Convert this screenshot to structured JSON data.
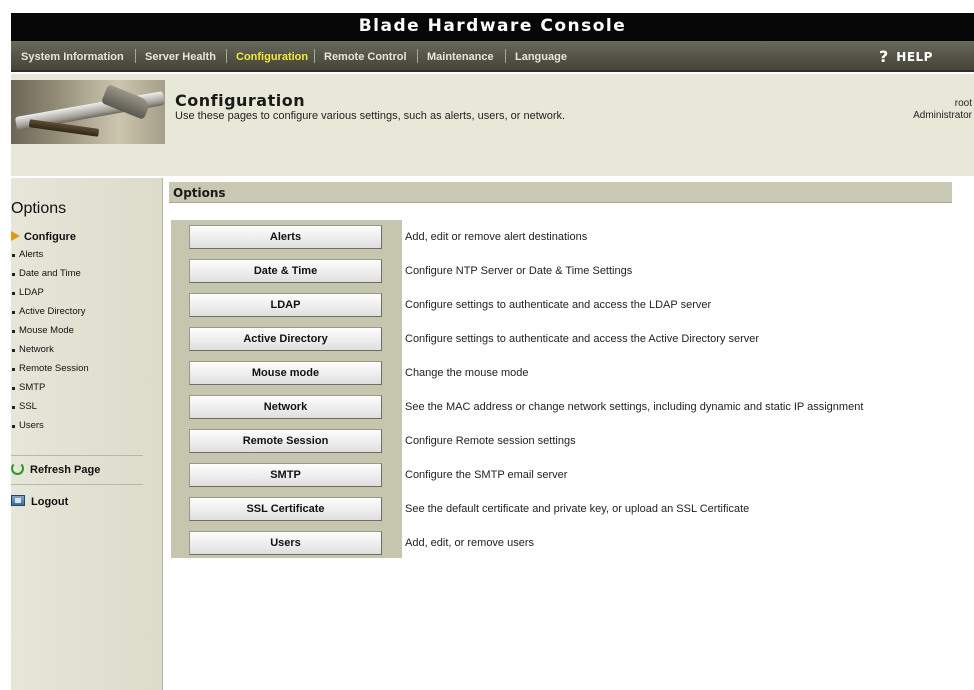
{
  "window": {
    "title": "Blade Hardware Console"
  },
  "nav": {
    "items": [
      {
        "label": "System Information",
        "active": false
      },
      {
        "label": "Server Health",
        "active": false
      },
      {
        "label": "Configuration",
        "active": true
      },
      {
        "label": "Remote Control",
        "active": false
      },
      {
        "label": "Maintenance",
        "active": false
      },
      {
        "label": "Language",
        "active": false
      }
    ],
    "help": {
      "icon": "question-icon",
      "glyph": "?",
      "label": "HELP"
    }
  },
  "banner": {
    "logo_icon": "hammer-tools-logo",
    "title": "Configuration",
    "description": "Use these pages to configure various settings, such as alerts, users, or network.",
    "user": "root",
    "role": "Administrator"
  },
  "sidebar": {
    "title": "Options",
    "group": {
      "label": "Configure",
      "icon": "triangle-right-icon"
    },
    "items": [
      "Alerts",
      "Date and Time",
      "LDAP",
      "Active Directory",
      "Mouse Mode",
      "Network",
      "Remote Session",
      "SMTP",
      "SSL",
      "Users"
    ],
    "actions": [
      {
        "label": "Refresh Page",
        "icon": "refresh-icon"
      },
      {
        "label": "Logout",
        "icon": "logout-icon"
      }
    ]
  },
  "content": {
    "header": "Options",
    "options": [
      {
        "button": "Alerts",
        "description": "Add, edit or remove alert destinations"
      },
      {
        "button": "Date & Time",
        "description": "Configure NTP Server or Date & Time Settings"
      },
      {
        "button": "LDAP",
        "description": "Configure settings to authenticate and access the LDAP server"
      },
      {
        "button": "Active Directory",
        "description": "Configure settings to authenticate and access the Active Directory server"
      },
      {
        "button": "Mouse mode",
        "description": "Change the mouse mode"
      },
      {
        "button": "Network",
        "description": "See the MAC address or change network settings, including dynamic and static IP assignment"
      },
      {
        "button": "Remote Session",
        "description": "Configure Remote session settings"
      },
      {
        "button": "SMTP",
        "description": "Configure the SMTP email server"
      },
      {
        "button": "SSL Certificate",
        "description": "See the default certificate and private key, or upload an SSL Certificate"
      },
      {
        "button": "Users",
        "description": "Add, edit, or remove users"
      }
    ]
  },
  "colors": {
    "titlebar": "#070707",
    "nav_active": "#f3ea3a",
    "panel": "#c6c6ae",
    "options_bar": "#c9c9b3",
    "banner": "#e8e8d8"
  }
}
